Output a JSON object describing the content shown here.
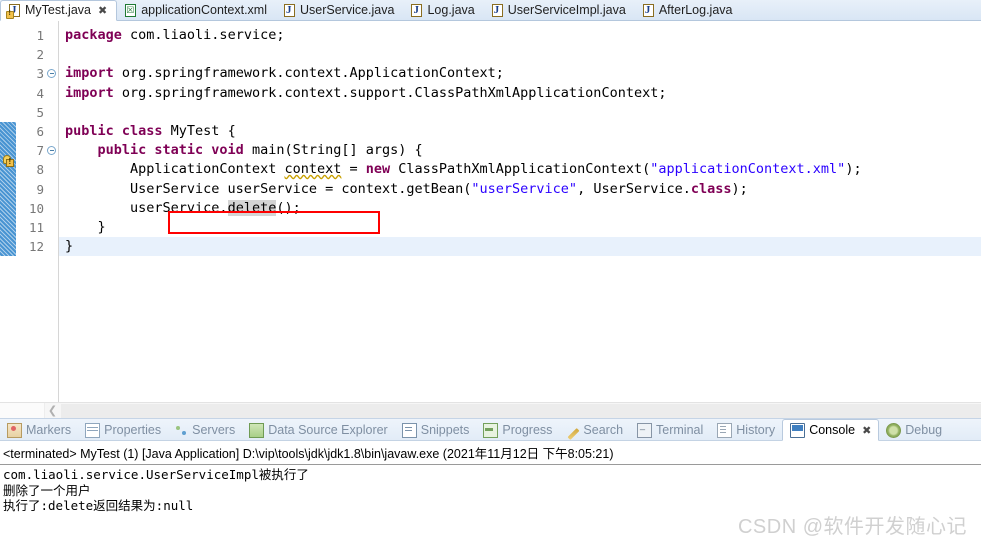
{
  "editor_tabs": [
    {
      "label": "MyTest.java",
      "icon": "java-warning-file-icon",
      "active": true,
      "closable": true
    },
    {
      "label": "applicationContext.xml",
      "icon": "xml-file-icon",
      "active": false,
      "closable": false
    },
    {
      "label": "UserService.java",
      "icon": "java-file-icon",
      "active": false,
      "closable": false
    },
    {
      "label": "Log.java",
      "icon": "java-file-icon",
      "active": false,
      "closable": false
    },
    {
      "label": "UserServiceImpl.java",
      "icon": "java-file-icon",
      "active": false,
      "closable": false
    },
    {
      "label": "AfterLog.java",
      "icon": "java-file-icon",
      "active": false,
      "closable": false
    }
  ],
  "close_glyph": "✖",
  "code": {
    "language": "java",
    "lines": [
      {
        "num": "1",
        "fold": false,
        "current": false,
        "tokens": [
          {
            "t": "package ",
            "c": "kw"
          },
          {
            "t": "com.liaoli.service;",
            "c": "plain"
          }
        ]
      },
      {
        "num": "2",
        "fold": false,
        "current": false,
        "tokens": []
      },
      {
        "num": "3",
        "fold": true,
        "current": false,
        "tokens": [
          {
            "t": "import ",
            "c": "kw"
          },
          {
            "t": "org.springframework.context.ApplicationContext;",
            "c": "plain"
          }
        ]
      },
      {
        "num": "4",
        "fold": false,
        "current": false,
        "tokens": [
          {
            "t": "import ",
            "c": "kw"
          },
          {
            "t": "org.springframework.context.support.ClassPathXmlApplicationContext;",
            "c": "plain"
          }
        ]
      },
      {
        "num": "5",
        "fold": false,
        "current": false,
        "tokens": []
      },
      {
        "num": "6",
        "fold": false,
        "current": false,
        "tokens": [
          {
            "t": "public class ",
            "c": "kw"
          },
          {
            "t": "MyTest {",
            "c": "plain"
          }
        ]
      },
      {
        "num": "7",
        "fold": true,
        "current": false,
        "tokens": [
          {
            "t": "    ",
            "c": "plain"
          },
          {
            "t": "public static void ",
            "c": "kw"
          },
          {
            "t": "main(String[] args) {",
            "c": "plain"
          }
        ]
      },
      {
        "num": "8",
        "fold": false,
        "current": false,
        "tokens": [
          {
            "t": "        ApplicationContext ",
            "c": "plain"
          },
          {
            "t": "context",
            "c": "underl-warn"
          },
          {
            "t": " = ",
            "c": "plain"
          },
          {
            "t": "new ",
            "c": "kw"
          },
          {
            "t": "ClassPathXmlApplicationContext(",
            "c": "plain"
          },
          {
            "t": "\"applicationContext.xml\"",
            "c": "str"
          },
          {
            "t": ");",
            "c": "plain"
          }
        ]
      },
      {
        "num": "9",
        "fold": false,
        "current": false,
        "tokens": [
          {
            "t": "        UserService userService = context.getBean(",
            "c": "plain"
          },
          {
            "t": "\"userService\"",
            "c": "str"
          },
          {
            "t": ", UserService.",
            "c": "plain"
          },
          {
            "t": "class",
            "c": "kw"
          },
          {
            "t": ");",
            "c": "plain"
          }
        ]
      },
      {
        "num": "10",
        "fold": false,
        "current": false,
        "tokens": [
          {
            "t": "        userService.",
            "c": "plain"
          },
          {
            "t": "delete",
            "c": "occ-highlight"
          },
          {
            "t": "();",
            "c": "plain"
          }
        ]
      },
      {
        "num": "11",
        "fold": false,
        "current": false,
        "tokens": [
          {
            "t": "    }",
            "c": "plain"
          }
        ]
      },
      {
        "num": "12",
        "fold": false,
        "current": true,
        "tokens": [
          {
            "t": "}",
            "c": "plain"
          }
        ]
      }
    ]
  },
  "annotations": {
    "warning_marker_line": 8,
    "quick_diff_from_line": 6,
    "red_box_target": "userService.delete();"
  },
  "editor_scrollbar": {
    "left_arrow": "❮"
  },
  "view_tabs": [
    {
      "label": "Markers",
      "icon": "markers-icon",
      "active": false
    },
    {
      "label": "Properties",
      "icon": "properties-icon",
      "active": false
    },
    {
      "label": "Servers",
      "icon": "servers-icon",
      "active": false
    },
    {
      "label": "Data Source Explorer",
      "icon": "data-source-explorer-icon",
      "active": false
    },
    {
      "label": "Snippets",
      "icon": "snippets-icon",
      "active": false
    },
    {
      "label": "Progress",
      "icon": "progress-icon",
      "active": false
    },
    {
      "label": "Search",
      "icon": "search-icon",
      "active": false
    },
    {
      "label": "Terminal",
      "icon": "terminal-icon",
      "active": false
    },
    {
      "label": "History",
      "icon": "history-icon",
      "active": false
    },
    {
      "label": "Console",
      "icon": "console-icon",
      "active": true,
      "closable": true
    },
    {
      "label": "Debug",
      "icon": "debug-icon",
      "active": false
    }
  ],
  "console": {
    "header": "<terminated> MyTest (1) [Java Application] D:\\vip\\tools\\jdk\\jdk1.8\\bin\\javaw.exe (2021年11月12日 下午8:05:21)",
    "output_lines": [
      "com.liaoli.service.UserServiceImpl被执行了",
      "删除了一个用户",
      "执行了:delete返回结果为:null"
    ]
  },
  "watermark": "CSDN @软件开发随心记",
  "colors": {
    "keyword": "#7f0055",
    "string": "#2a00ff",
    "highlight_box": "#ff0000",
    "current_line": "#e8f1fc",
    "quick_diff": "#3f8fd0",
    "tabbar_gradient_top": "#e8f0f9",
    "tabbar_gradient_bottom": "#d9e6f5"
  }
}
